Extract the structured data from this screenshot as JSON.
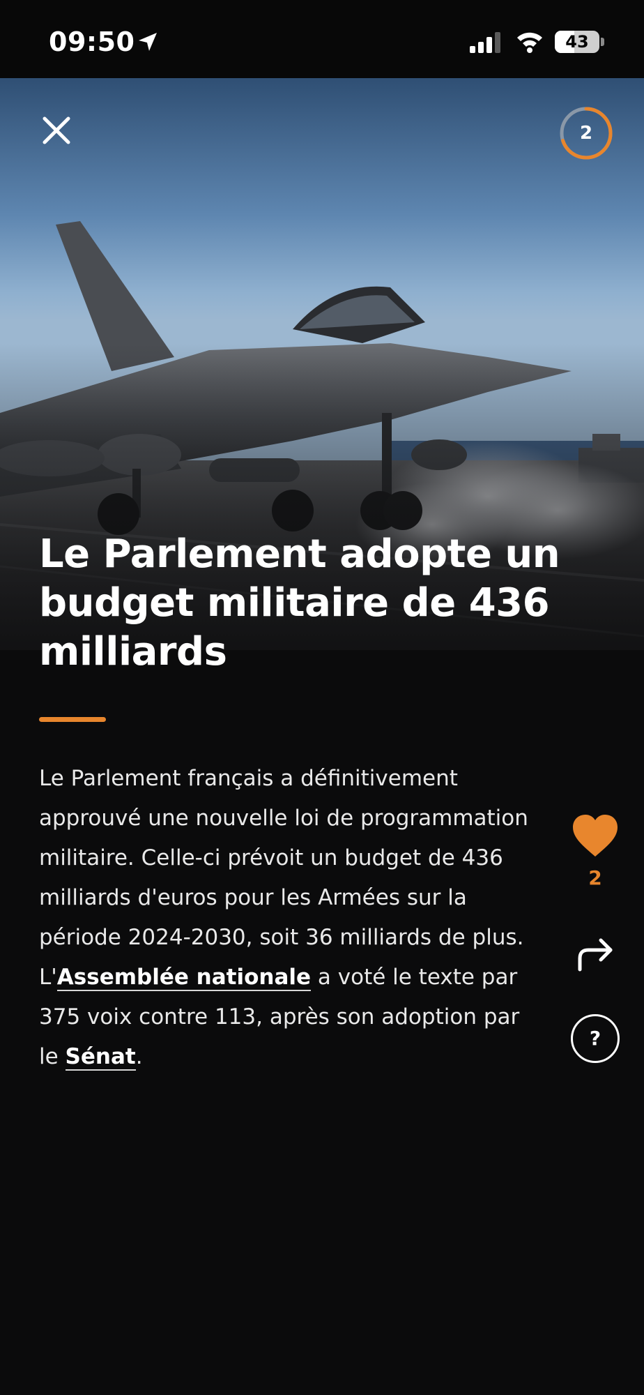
{
  "status_bar": {
    "time": "09:50",
    "battery_level": "43",
    "icons": [
      "location-arrow-icon",
      "signal-icon",
      "wifi-icon",
      "battery-icon"
    ]
  },
  "header": {
    "close_icon": "close-icon",
    "progress_count": "2",
    "progress_fraction": 0.7
  },
  "article": {
    "title": "Le Parlement adopte un budget militaire de 436 milliards",
    "body_part1": "Le Parlement français a définitivement approuvé une nouvelle loi de programmation militaire. Celle-ci prévoit un budget de 436 milliards d'euros pour les Armées sur la période 2024-2030, soit 36 milliards de plus. L'",
    "link1": "Assemblée nationale",
    "body_part2": " a voté le texte par 375 voix contre 113, après son adoption par le ",
    "link2": "Sénat",
    "body_part3": "."
  },
  "actions": {
    "like_count": "2",
    "icons": [
      "heart-icon",
      "share-icon",
      "help-icon"
    ],
    "help_label": "?"
  },
  "colors": {
    "accent": "#e8862d",
    "background": "#0b0b0c",
    "text": "#ffffff"
  }
}
